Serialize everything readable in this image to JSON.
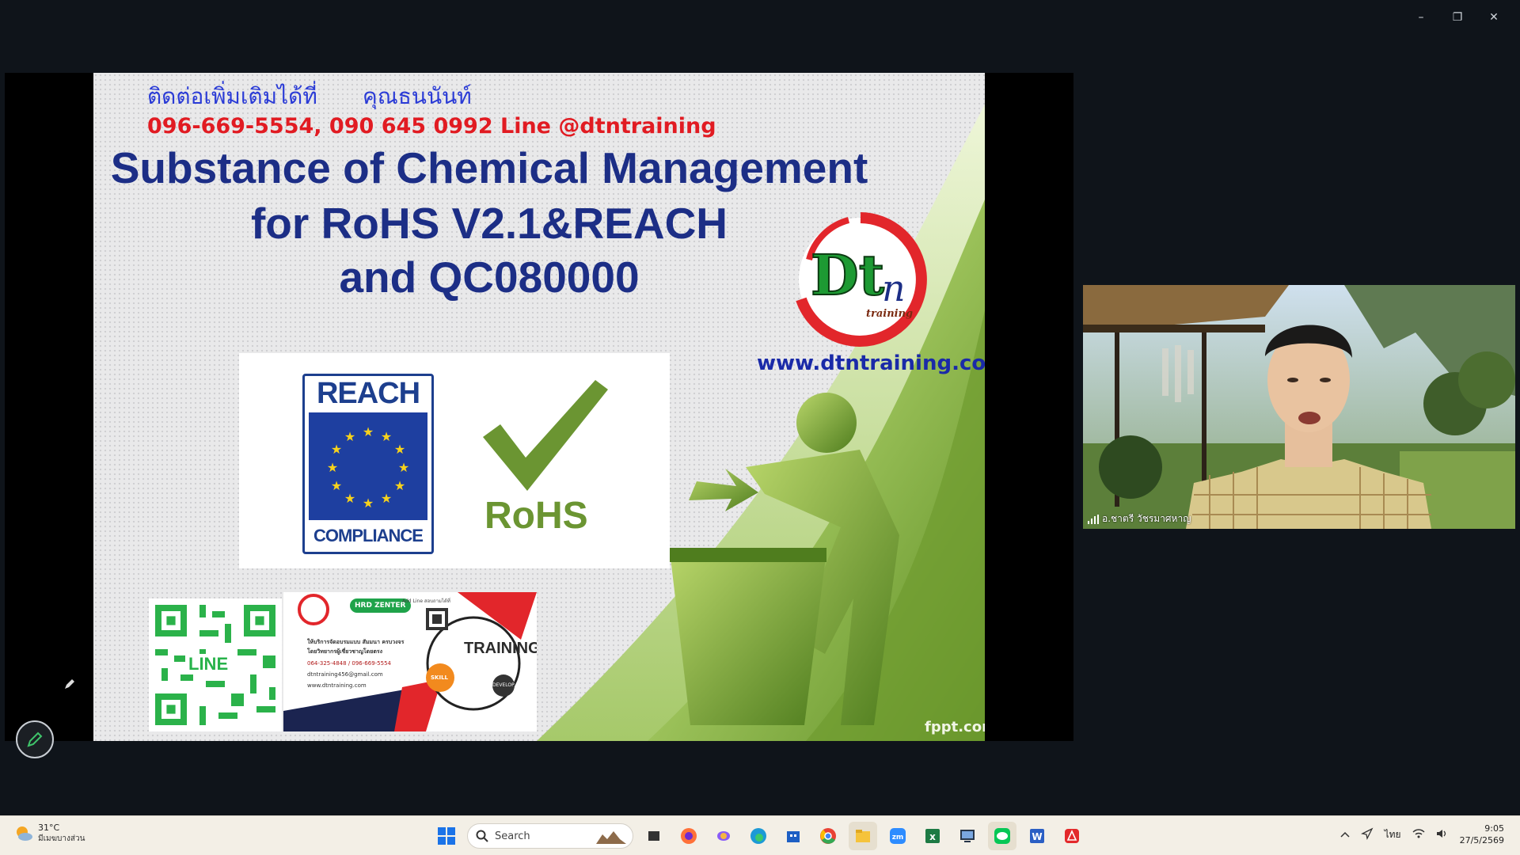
{
  "window": {
    "controls": [
      "–",
      "❐",
      "✕"
    ]
  },
  "slide": {
    "contact_prefix": "ติดต่อเพิ่มเติมได้ที่",
    "contact_name": "คุณธนนันท์",
    "phones": "096-669-5554, 090 645 0992 Line @dtntraining",
    "title_line1": "Substance of Chemical Management",
    "title_line2": "for RoHS V2.1&REACH",
    "title_line3": "and QC080000",
    "logo_letters": "Dt",
    "logo_n": "n",
    "logo_sub": "training",
    "website": "www.dtntraining.com",
    "reach_top": "REACH",
    "reach_bottom": "COMPLIANCE",
    "rohs_label": "RoHS",
    "qr_label": "LINE",
    "flyer": {
      "hrd_badge": "HRD ZENTER",
      "add_line": "Add Line สอบถามได้ที่",
      "desc1": "ให้บริการจัดอบรมแบบ สัมมนา ครบวงจร",
      "desc2": "โดยวิทยากรผู้เชี่ยวชาญโดยตรง",
      "phone": "064-325-4848 / 096-669-5554",
      "email": "dtntraining456@gmail.com",
      "web": "www.dtntraining.com",
      "training": "TRAINING",
      "skill": "SKILL",
      "develop": "DEVELOP"
    },
    "watermark": "fppt.com",
    "colors": {
      "title": "#1c2e86",
      "phones": "#e11b22",
      "contact": "#2a3bd6",
      "green_dark": "#4f7d1e",
      "green_light": "#b6d46a"
    }
  },
  "webcam": {
    "participant_name": "อ.ชาตรี วัชรมาศหาญ",
    "signal_icon": "signal-bars-icon"
  },
  "taskbar": {
    "weather_temp": "31°C",
    "weather_desc": "มีเมฆบางส่วน",
    "search_placeholder": "Search",
    "apps": [
      "windows-start-icon",
      "search-icon",
      "task-view-icon",
      "firefox-icon",
      "copilot-icon",
      "edge-icon",
      "store-icon",
      "chrome-icon",
      "file-explorer-icon",
      "zoom-icon",
      "excel-icon",
      "remote-desktop-icon",
      "line-icon",
      "word-icon",
      "acrobat-icon"
    ],
    "language": "ไทย",
    "time": "9:05",
    "date": "27/5/2569"
  }
}
